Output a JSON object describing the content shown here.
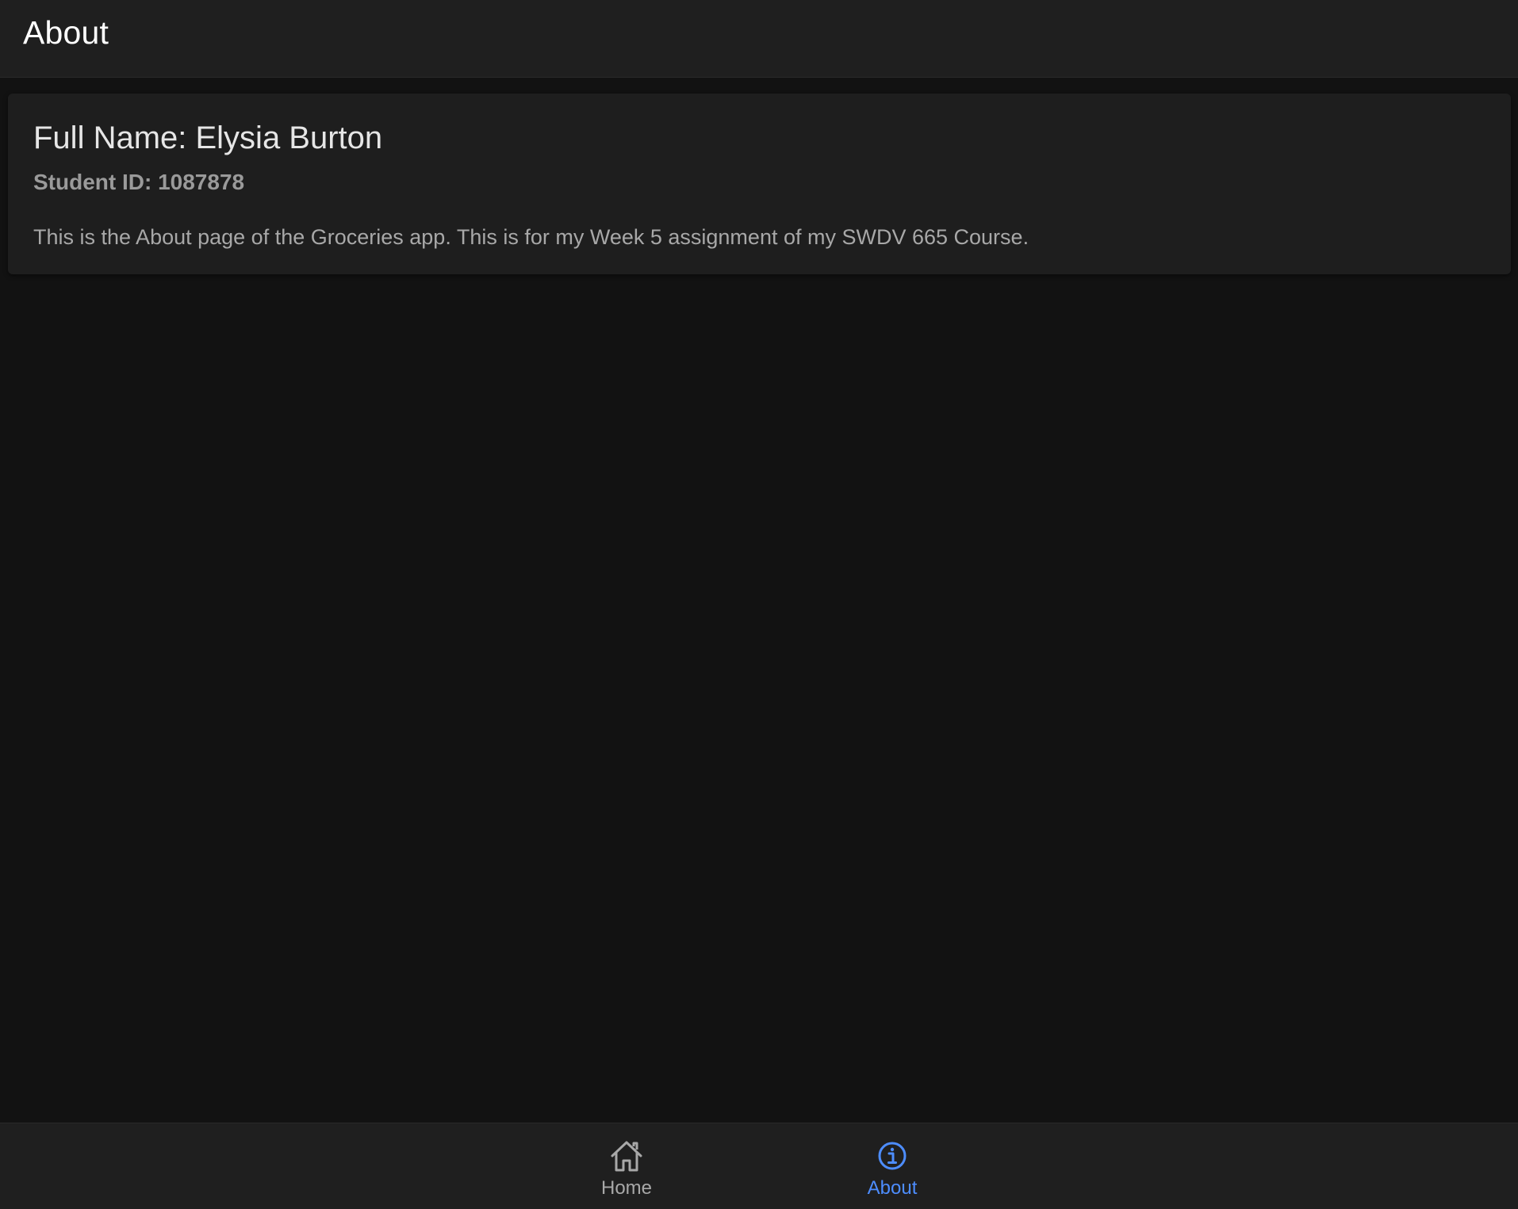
{
  "header": {
    "title": "About"
  },
  "card": {
    "title": "Full Name: Elysia Burton",
    "subtitle": "Student ID: 1087878",
    "body": "This is the About page of the Groceries app. This is for my Week 5 assignment of my SWDV 665 Course."
  },
  "tabs": [
    {
      "label": "Home",
      "icon": "home-icon",
      "selected": false
    },
    {
      "label": "About",
      "icon": "info-icon",
      "selected": true
    }
  ],
  "colors": {
    "accent": "#4d8dff",
    "background": "#121212",
    "surface": "#1e1e1e"
  }
}
